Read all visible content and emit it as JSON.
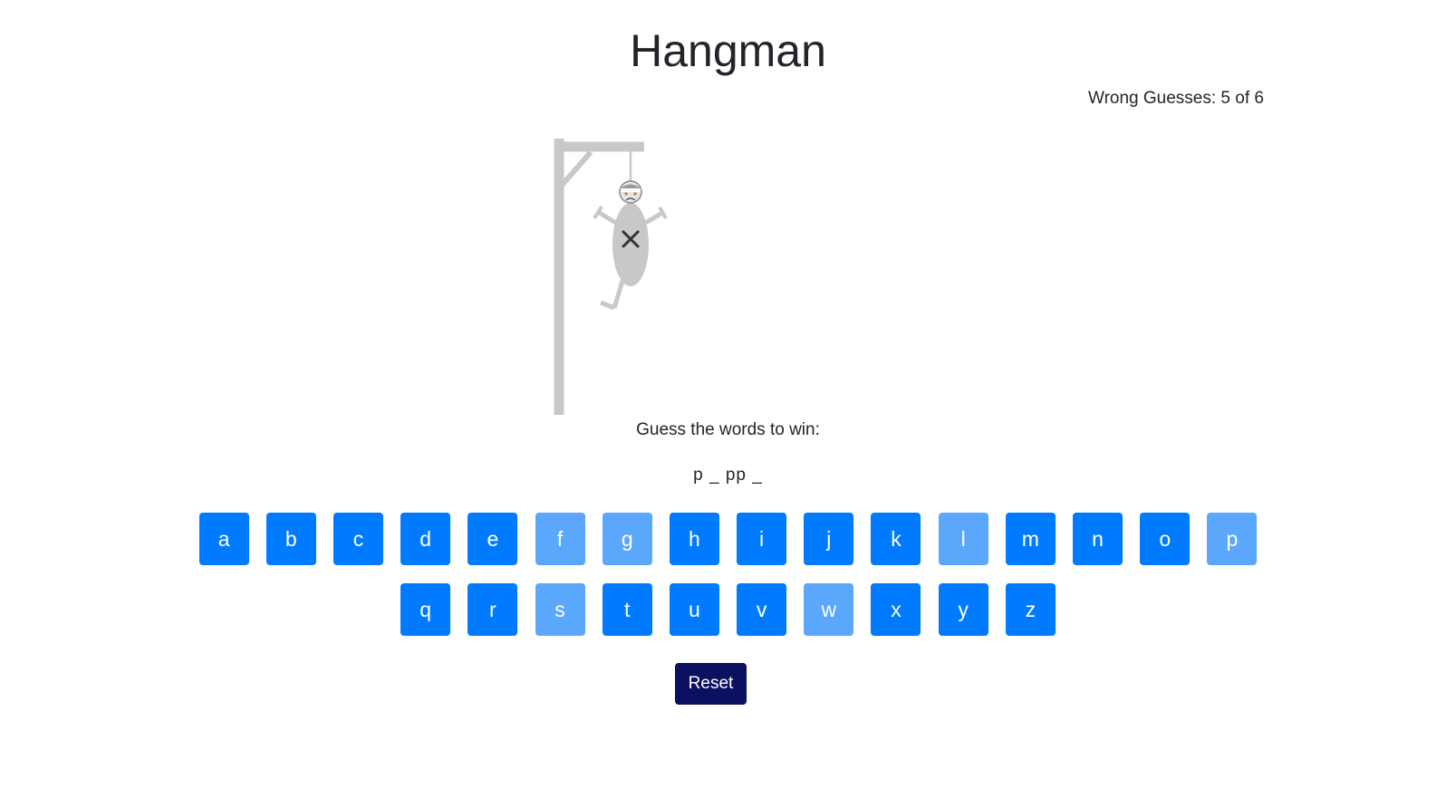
{
  "title": "Hangman",
  "status": {
    "wrong_label": "Wrong Guesses:",
    "wrong_count": "5",
    "of_label": "of",
    "max_wrong": "6"
  },
  "prompt": "Guess the words to win:",
  "word_display": "p _ pp _",
  "keyboard": {
    "row1": [
      {
        "letter": "a",
        "used": false
      },
      {
        "letter": "b",
        "used": false
      },
      {
        "letter": "c",
        "used": false
      },
      {
        "letter": "d",
        "used": false
      },
      {
        "letter": "e",
        "used": false
      },
      {
        "letter": "f",
        "used": true
      },
      {
        "letter": "g",
        "used": true
      },
      {
        "letter": "h",
        "used": false
      },
      {
        "letter": "i",
        "used": false
      },
      {
        "letter": "j",
        "used": false
      },
      {
        "letter": "k",
        "used": false
      },
      {
        "letter": "l",
        "used": true
      },
      {
        "letter": "m",
        "used": false
      },
      {
        "letter": "n",
        "used": false
      },
      {
        "letter": "o",
        "used": false
      },
      {
        "letter": "p",
        "used": true
      }
    ],
    "row2": [
      {
        "letter": "q",
        "used": false
      },
      {
        "letter": "r",
        "used": false
      },
      {
        "letter": "s",
        "used": true
      },
      {
        "letter": "t",
        "used": false
      },
      {
        "letter": "u",
        "used": false
      },
      {
        "letter": "v",
        "used": false
      },
      {
        "letter": "w",
        "used": true
      },
      {
        "letter": "x",
        "used": false
      },
      {
        "letter": "y",
        "used": false
      },
      {
        "letter": "z",
        "used": false
      }
    ]
  },
  "reset_label": "Reset",
  "colors": {
    "key_active": "#007bff",
    "key_used": "#5aa7fc",
    "reset_bg": "#0b1160",
    "gallows": "#c8c8c8"
  }
}
